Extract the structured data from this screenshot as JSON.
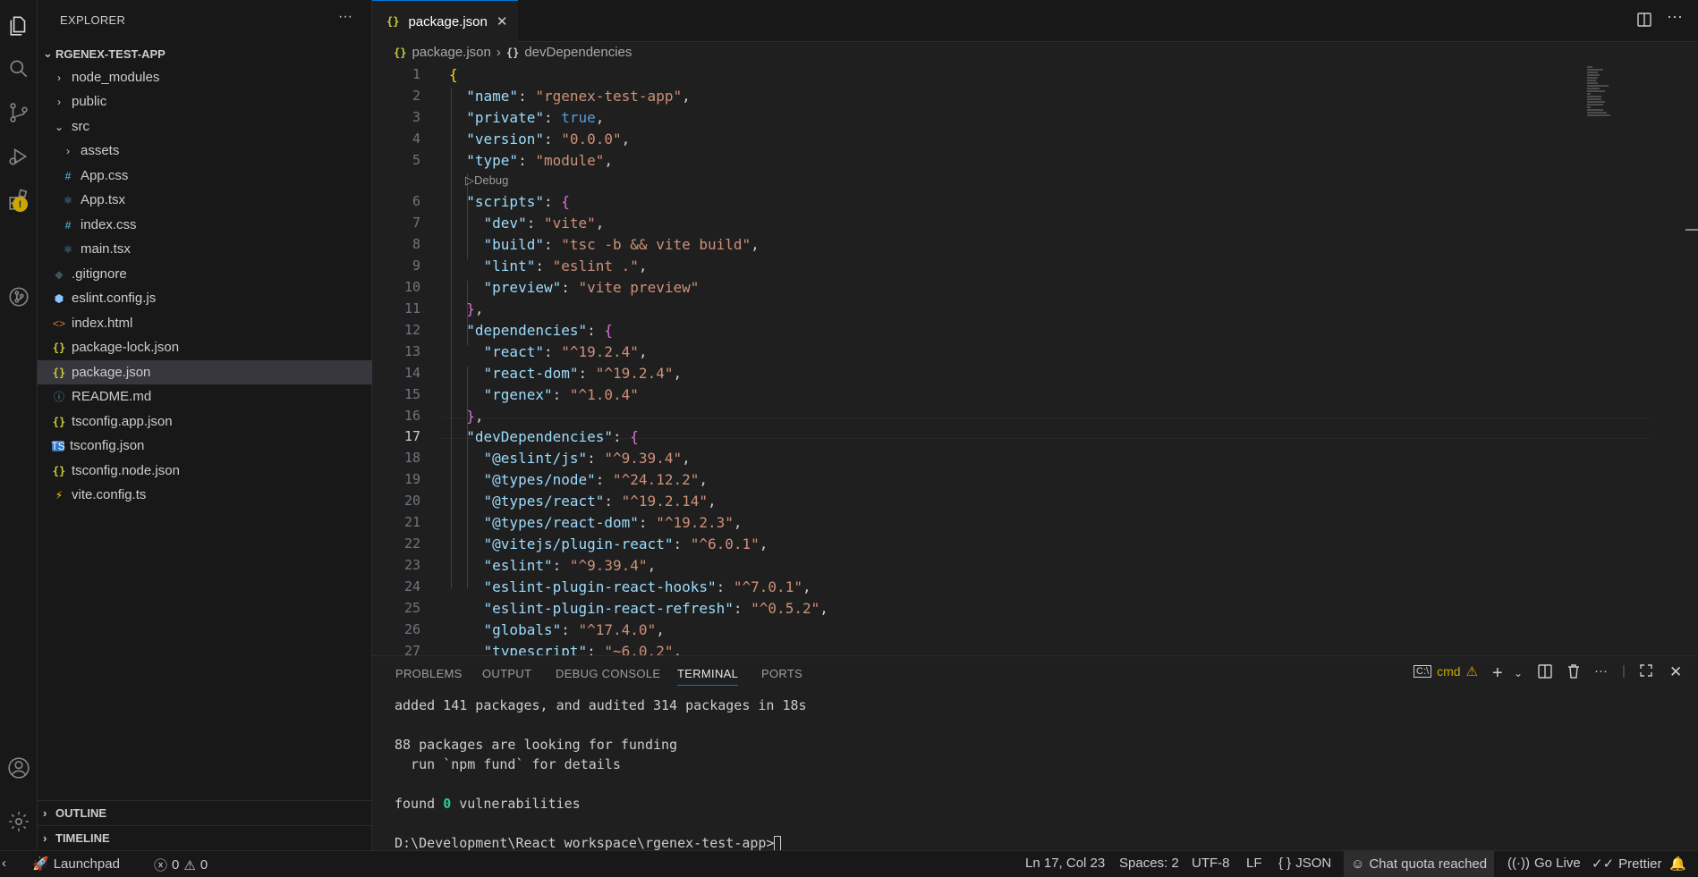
{
  "sidebar": {
    "title": "EXPLORER",
    "project": "RGENEX-TEST-APP",
    "tree": [
      {
        "label": "node_modules",
        "icon": "chevron-right-icon"
      },
      {
        "label": "public",
        "icon": "chevron-right-icon"
      },
      {
        "label": "src",
        "icon": "chevron-down-icon"
      },
      {
        "label": "assets",
        "icon": "chevron-right-icon"
      },
      {
        "label": "App.css",
        "icon": "css-file-icon"
      },
      {
        "label": "App.tsx",
        "icon": "react-file-icon"
      },
      {
        "label": "index.css",
        "icon": "css-file-icon"
      },
      {
        "label": "main.tsx",
        "icon": "react-file-icon"
      },
      {
        "label": ".gitignore",
        "icon": "git-file-icon"
      },
      {
        "label": "eslint.config.js",
        "icon": "eslint-file-icon"
      },
      {
        "label": "index.html",
        "icon": "html-file-icon"
      },
      {
        "label": "package-lock.json",
        "icon": "json-file-icon"
      },
      {
        "label": "package.json",
        "icon": "json-file-icon"
      },
      {
        "label": "README.md",
        "icon": "info-file-icon"
      },
      {
        "label": "tsconfig.app.json",
        "icon": "json-file-icon"
      },
      {
        "label": "tsconfig.json",
        "icon": "ts-file-icon"
      },
      {
        "label": "tsconfig.node.json",
        "icon": "json-file-icon"
      },
      {
        "label": "vite.config.ts",
        "icon": "vite-file-icon"
      }
    ],
    "outline": "OUTLINE",
    "timeline": "TIMELINE"
  },
  "editor": {
    "tab": "package.json",
    "breadcrumb": [
      "package.json",
      "devDependencies"
    ],
    "code_lens": "Debug",
    "current_line": 17
  },
  "panel": {
    "tabs": [
      "PROBLEMS",
      "OUTPUT",
      "DEBUG CONSOLE",
      "TERMINAL",
      "PORTS"
    ],
    "active_tab": "TERMINAL",
    "shell": "cmd",
    "terminal": {
      "line1": "added 141 packages, and audited 314 packages in 18s",
      "line2": "88 packages are looking for funding",
      "line3": "  run `npm fund` for details",
      "line4_pre": "found ",
      "line4_num": "0",
      "line4_post": " vulnerabilities",
      "prompt": "D:\\Development\\React_workspace\\rgenex-test-app>"
    }
  },
  "status": {
    "launchpad": "Launchpad",
    "errors": "0",
    "warnings": "0",
    "position": "Ln 17, Col 23",
    "spaces": "Spaces: 2",
    "encoding": "UTF-8",
    "eol": "LF",
    "language": "JSON",
    "chat": "Chat quota reached",
    "golive": "Go Live",
    "prettier": "Prettier"
  },
  "colors": {
    "accent": "#0078d4",
    "warning": "#cca700",
    "string": "#ce9178",
    "key": "#9cdcfe"
  }
}
